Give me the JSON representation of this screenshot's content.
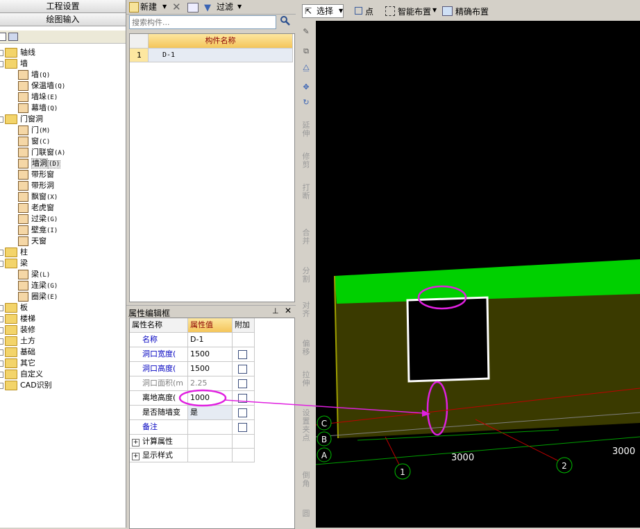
{
  "left_panel": {
    "btn_settings": "工程设置",
    "btn_draw": "绘图输入",
    "tree": [
      {
        "label": "轴线",
        "level": 0,
        "type": "folder"
      },
      {
        "label": "墙",
        "level": 0,
        "type": "folder-open"
      },
      {
        "label": "墙",
        "code": "(Q)",
        "level": 1
      },
      {
        "label": "保温墙",
        "code": "(Q)",
        "level": 1
      },
      {
        "label": "墙垛",
        "code": "(E)",
        "level": 1
      },
      {
        "label": "幕墙",
        "code": "(Q)",
        "level": 1
      },
      {
        "label": "门窗洞",
        "level": 0,
        "type": "folder-open"
      },
      {
        "label": "门",
        "code": "(M)",
        "level": 1
      },
      {
        "label": "窗",
        "code": "(C)",
        "level": 1
      },
      {
        "label": "门联窗",
        "code": "(A)",
        "level": 1
      },
      {
        "label": "墙洞",
        "code": "(D)",
        "level": 1,
        "selected": true
      },
      {
        "label": "带形窗",
        "code": "",
        "level": 1
      },
      {
        "label": "带形洞",
        "code": "",
        "level": 1
      },
      {
        "label": "飘窗",
        "code": "(X)",
        "level": 1
      },
      {
        "label": "老虎窗",
        "code": "",
        "level": 1
      },
      {
        "label": "过梁",
        "code": "(G)",
        "level": 1
      },
      {
        "label": "壁龛",
        "code": "(I)",
        "level": 1
      },
      {
        "label": "天窗",
        "code": "",
        "level": 1
      },
      {
        "label": "柱",
        "level": 0,
        "type": "folder"
      },
      {
        "label": "梁",
        "level": 0,
        "type": "folder-open"
      },
      {
        "label": "梁",
        "code": "(L)",
        "level": 1
      },
      {
        "label": "连梁",
        "code": "(G)",
        "level": 1
      },
      {
        "label": "圈梁",
        "code": "(E)",
        "level": 1
      },
      {
        "label": "板",
        "level": 0,
        "type": "folder"
      },
      {
        "label": "楼梯",
        "level": 0,
        "type": "folder"
      },
      {
        "label": "装修",
        "level": 0,
        "type": "folder"
      },
      {
        "label": "土方",
        "level": 0,
        "type": "folder"
      },
      {
        "label": "基础",
        "level": 0,
        "type": "folder"
      },
      {
        "label": "其它",
        "level": 0,
        "type": "folder"
      },
      {
        "label": "自定义",
        "level": 0,
        "type": "folder"
      },
      {
        "label": "CAD识别",
        "level": 0,
        "type": "folder"
      }
    ]
  },
  "component_list": {
    "toolbar": {
      "new_label": "新建",
      "filter_label": "过滤"
    },
    "search_placeholder": "搜索构件...",
    "header": "构件名称",
    "rows": [
      {
        "num": "1",
        "name": "D-1"
      }
    ]
  },
  "properties": {
    "title": "属性编辑框",
    "columns": [
      "属性名称",
      "属性值",
      "附加"
    ],
    "rows": [
      {
        "name": "名称",
        "value": "D-1",
        "color": "#0000c0",
        "check": false
      },
      {
        "name": "洞口宽度(",
        "value": "1500",
        "color": "#0000c0",
        "check": true
      },
      {
        "name": "洞口高度(",
        "value": "1500",
        "color": "#0000c0",
        "check": true
      },
      {
        "name": "洞口面积(m",
        "value": "2.25",
        "color": "#808080",
        "check": true
      },
      {
        "name": "离地高度(",
        "value": "1000",
        "color": "#000000",
        "check": true
      },
      {
        "name": "是否随墙变",
        "value": "是",
        "color": "#000000",
        "check": true
      },
      {
        "name": "备注",
        "value": "",
        "color": "#0000c0",
        "check": true
      }
    ],
    "groups": [
      "计算属性",
      "显示样式"
    ]
  },
  "top_toolbar": {
    "select_label": "选择",
    "point_label": "点",
    "smart_label": "智能布置",
    "precise_label": "精确布置"
  },
  "vertical_tools": [
    "延伸",
    "修剪",
    "打断",
    "合并",
    "分割",
    "对齐",
    "偏移",
    "拉伸",
    "设置夹点",
    "倒角",
    "圆"
  ],
  "canvas": {
    "axis_letters": [
      "C",
      "B",
      "A"
    ],
    "axis_numbers": [
      "1",
      "2"
    ],
    "dimensions": [
      "3000",
      "3000"
    ]
  }
}
